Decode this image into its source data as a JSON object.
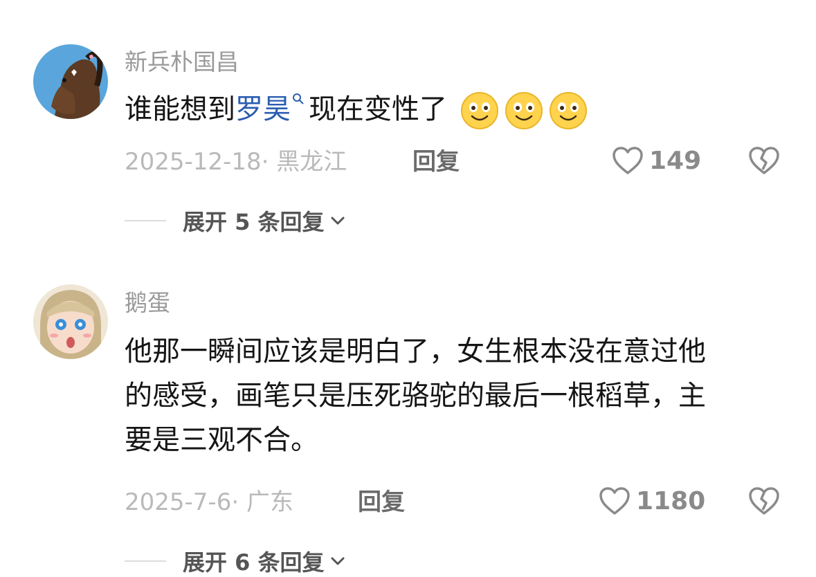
{
  "comments": [
    {
      "username": "新兵朴国昌",
      "text_before": "谁能想到",
      "keyword": "罗昊",
      "text_after": "现在变性了",
      "emoji_count": 3,
      "date": "2025-12-18",
      "location": "· 黑龙江",
      "reply_label": "回复",
      "likes": "149",
      "expand_label": "展开 5 条回复"
    },
    {
      "username": "鹅蛋",
      "lines": [
        "他那一瞬间应该是明白了，女生根本没在意过他",
        "的感受，画笔只是压死骆驼的最后一根稻草，主",
        "要是三观不合。"
      ],
      "date": "2025-7-6",
      "location": "· 广东",
      "reply_label": "回复",
      "likes": "1180",
      "expand_label": "展开 6 条回复"
    }
  ],
  "icons": {
    "like": "heart-outline-icon",
    "dislike": "broken-heart-icon",
    "expand": "chevron-down-icon",
    "keyword_search": "search-icon",
    "emoji": "smile-emoji-icon"
  },
  "colors": {
    "keyword": "#2a5db0",
    "meta": "#b9b9b9",
    "username": "#9a9a9a",
    "text": "#151515"
  }
}
